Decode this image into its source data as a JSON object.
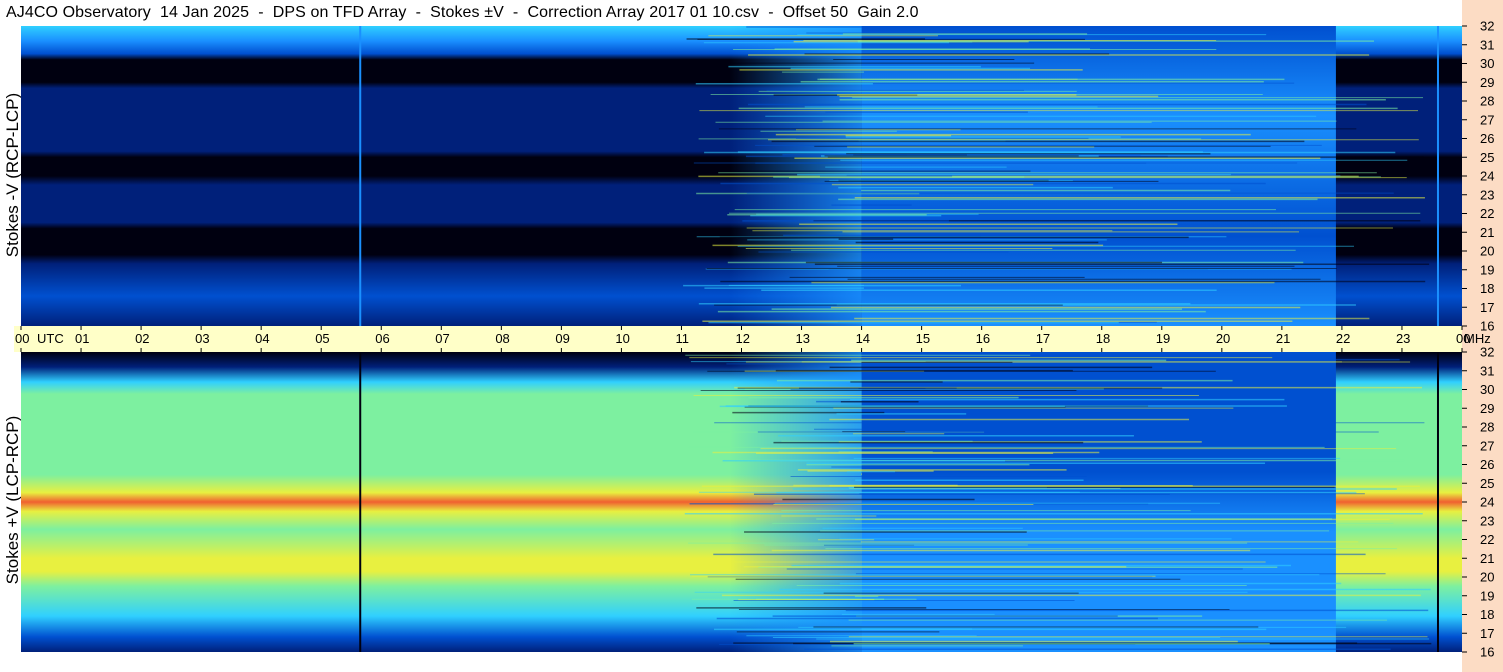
{
  "title": "AJ4CO Observatory  14 Jan 2025  -  DPS on TFD Array  -  Stokes ±V  -  Correction Array 2017 01 10.csv  -  Offset 50  Gain 2.0",
  "colors": {
    "background": "#ffffff",
    "time_axis_band": "#ffffc8",
    "freq_axis_band": "#fcdcc4",
    "colormap": [
      "#000010",
      "#00207a",
      "#0050d0",
      "#1a90ff",
      "#30d0ff",
      "#7df0a0",
      "#e8f040",
      "#f8a040",
      "#f06030"
    ]
  },
  "chart_data": {
    "type": "heatmap",
    "xaxis": {
      "unit_label": "UTC",
      "ticks": [
        "00",
        "01",
        "02",
        "03",
        "04",
        "05",
        "06",
        "07",
        "08",
        "09",
        "10",
        "11",
        "12",
        "13",
        "14",
        "15",
        "16",
        "17",
        "18",
        "19",
        "20",
        "21",
        "22",
        "23",
        "00"
      ],
      "range": [
        0,
        24
      ]
    },
    "panels": [
      {
        "ylabel": "Stokes -V (RCP-LCP)",
        "yunit": "MHz",
        "ylim": [
          16,
          32
        ],
        "yticks": [
          "32",
          "31",
          "30",
          "29",
          "28",
          "27",
          "26",
          "25",
          "24",
          "23",
          "22",
          "21",
          "20",
          "19",
          "18",
          "17",
          "16"
        ],
        "dark_bands_mhz": [
          [
            29,
            30.2
          ],
          [
            24,
            25
          ],
          [
            19.8,
            21.2
          ]
        ],
        "daytime_utc": [
          14.0,
          21.9
        ],
        "vertical_lines_utc": [
          5.65,
          23.6
        ]
      },
      {
        "ylabel": "Stokes +V (LCP-RCP)",
        "yunit": "MHz",
        "ylim": [
          16,
          32
        ],
        "yticks": [
          "32",
          "31",
          "30",
          "29",
          "28",
          "27",
          "26",
          "25",
          "24",
          "23",
          "22",
          "21",
          "20",
          "19",
          "18",
          "17",
          "16"
        ],
        "bright_bands_mhz": [
          [
            23.5,
            24.5
          ],
          [
            19.5,
            21
          ]
        ],
        "daytime_utc": [
          14.0,
          21.9
        ],
        "vertical_lines_utc": [
          5.65,
          23.6
        ]
      }
    ]
  }
}
